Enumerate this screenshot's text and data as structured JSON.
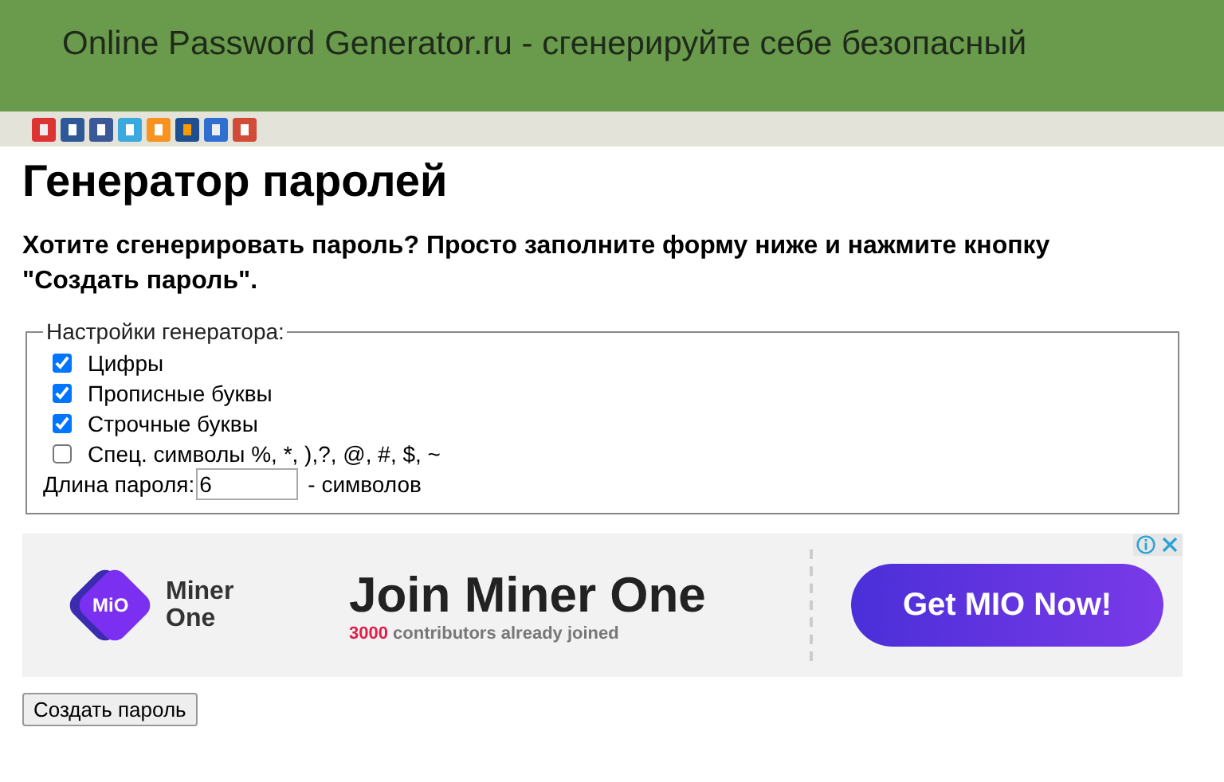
{
  "header": {
    "title": "Online Password Generator.ru - сгенерируйте себе безопасный"
  },
  "heading": "Генератор паролей",
  "intro": "Хотите сгенерировать пароль? Просто заполните форму ниже и нажмите кнопку \"Создать пароль\".",
  "settings": {
    "legend": "Настройки генератора:",
    "options": [
      {
        "label": "Цифры",
        "checked": true
      },
      {
        "label": "Прописные буквы",
        "checked": true
      },
      {
        "label": "Строчные буквы",
        "checked": true
      },
      {
        "label": "Спец. символы %, *, ),?, @, #, $, ~",
        "checked": false
      }
    ],
    "length": {
      "label": "Длина пароля:",
      "value": "6",
      "suffix": "- символов"
    }
  },
  "ad": {
    "logo_badge": "MiO",
    "logo_name": "Miner One",
    "title": "Join Miner One",
    "count": "3000",
    "subtitle": "contributors already joined",
    "cta": "Get MIO Now!"
  },
  "submit": "Создать пароль"
}
